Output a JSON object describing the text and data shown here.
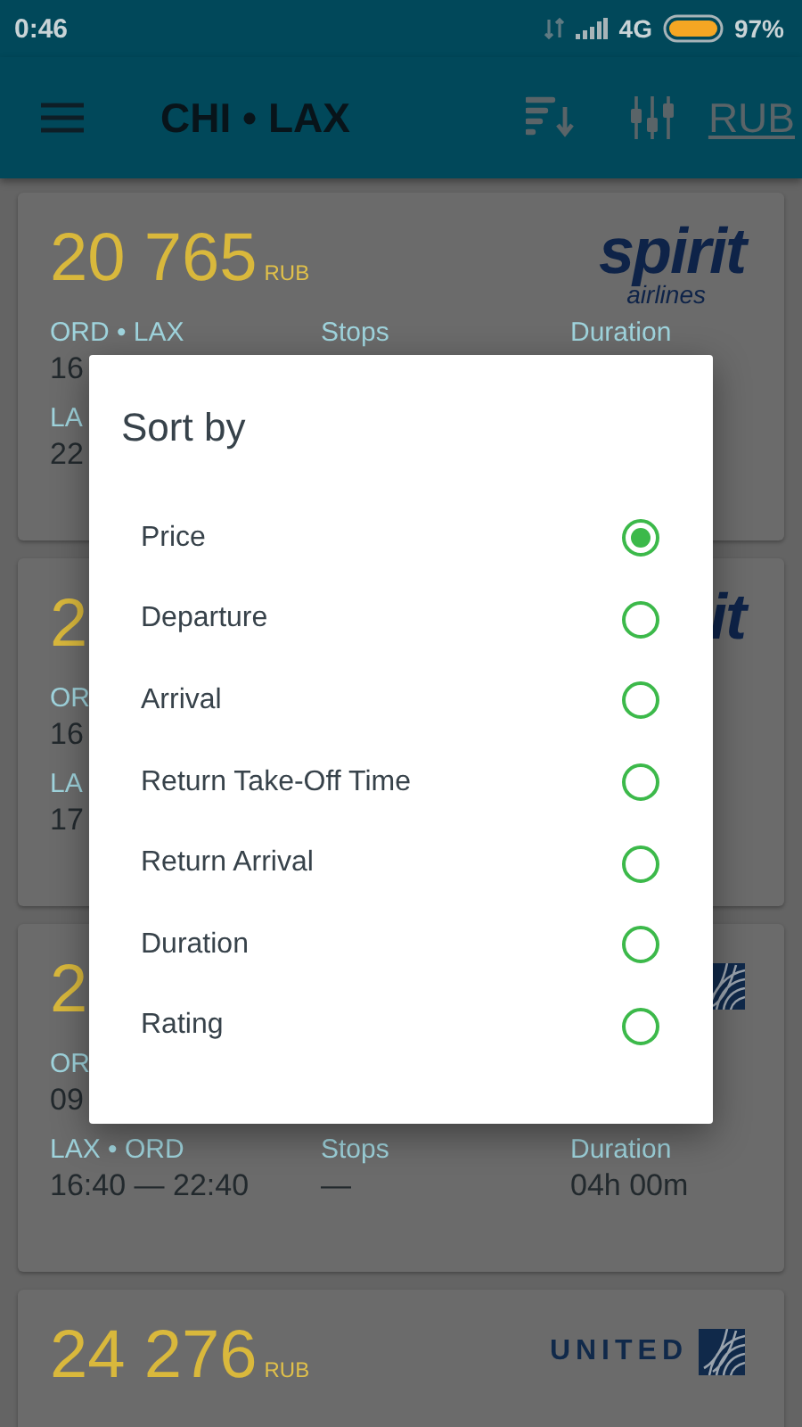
{
  "status_bar": {
    "time": "0:46",
    "network": "4G",
    "battery": "97%"
  },
  "app_bar": {
    "title": "CHI • LAX",
    "currency": "RUB"
  },
  "cards": [
    {
      "price": "20 765",
      "currency": "RUB",
      "logo": {
        "kind": "spirit",
        "word": "spirit",
        "sub": "airlines"
      },
      "legs": [
        [
          {
            "label": "ORD • LAX",
            "value": "16"
          },
          {
            "label": "Stops"
          },
          {
            "label": "Duration"
          }
        ],
        [
          {
            "label": "LA",
            "value": "22"
          }
        ]
      ]
    },
    {
      "price": "2",
      "logo": {
        "kind": "spirit",
        "word": "it"
      },
      "legs": [
        [
          {
            "label": "OR",
            "value": "16"
          }
        ],
        [
          {
            "label": "LA",
            "value": "17"
          }
        ]
      ]
    },
    {
      "price": "2",
      "logo": {
        "kind": "united"
      },
      "legs": [
        [
          {
            "label": "OR",
            "value": "09"
          }
        ],
        [
          {
            "label": "LAX • ORD",
            "value": "16:40 — 22:40"
          },
          {
            "label": "Stops",
            "value": "—"
          },
          {
            "label": "Duration",
            "value": "04h 00m"
          }
        ]
      ]
    },
    {
      "price": "24 276",
      "currency": "RUB",
      "logo": {
        "kind": "united",
        "word": "UNITED"
      }
    }
  ],
  "dialog": {
    "title": "Sort by",
    "options": [
      {
        "label": "Price",
        "selected": true
      },
      {
        "label": "Departure",
        "selected": false
      },
      {
        "label": "Arrival",
        "selected": false
      },
      {
        "label": "Return Take-Off Time",
        "selected": false
      },
      {
        "label": "Return Arrival",
        "selected": false
      },
      {
        "label": "Duration",
        "selected": false
      },
      {
        "label": "Rating",
        "selected": false
      }
    ]
  }
}
